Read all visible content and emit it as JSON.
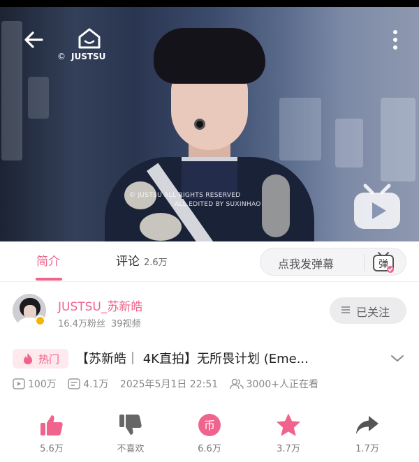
{
  "player": {
    "brand_copyright": "©",
    "brand_name": "JUSTSU",
    "watermark_line1": "© JUSTSU ALL RIGHTS RESERVED",
    "watermark_line2": "ALL EDITED BY SUXINHAO"
  },
  "tabs": {
    "intro_label": "简介",
    "comments_label": "评论",
    "comments_count": "2.6万",
    "danmaku_placeholder": "点我发弹幕"
  },
  "uploader": {
    "name": "JUSTSU_苏新皓",
    "fans": "16.4万粉丝",
    "videos": "39视频",
    "follow_label": "已关注"
  },
  "video": {
    "hot_label": "热门",
    "title": "【苏新皓｜ 4K直拍】无所畏计划 (Eme...",
    "plays": "100万",
    "danmaku_count": "4.1万",
    "date": "2025年5月1日 22:51",
    "watching": "3000+人正在看"
  },
  "actions": {
    "like": "5.6万",
    "dislike": "不喜欢",
    "coin": "6.6万",
    "favorite": "3.7万",
    "share": "1.7万"
  },
  "colors": {
    "accent": "#f0638c",
    "follow_bg": "#ececef",
    "verify": "#f5b400"
  },
  "icons": [
    "back-arrow-icon",
    "home-icon",
    "more-vertical-icon",
    "tv-logo-icon",
    "danmaku-toggle-icon",
    "menu-icon",
    "flame-icon",
    "chevron-down-icon",
    "play-count-icon",
    "danmaku-count-icon",
    "viewers-icon",
    "thumbs-up-icon",
    "thumbs-down-icon",
    "coin-icon",
    "star-icon",
    "share-icon"
  ]
}
